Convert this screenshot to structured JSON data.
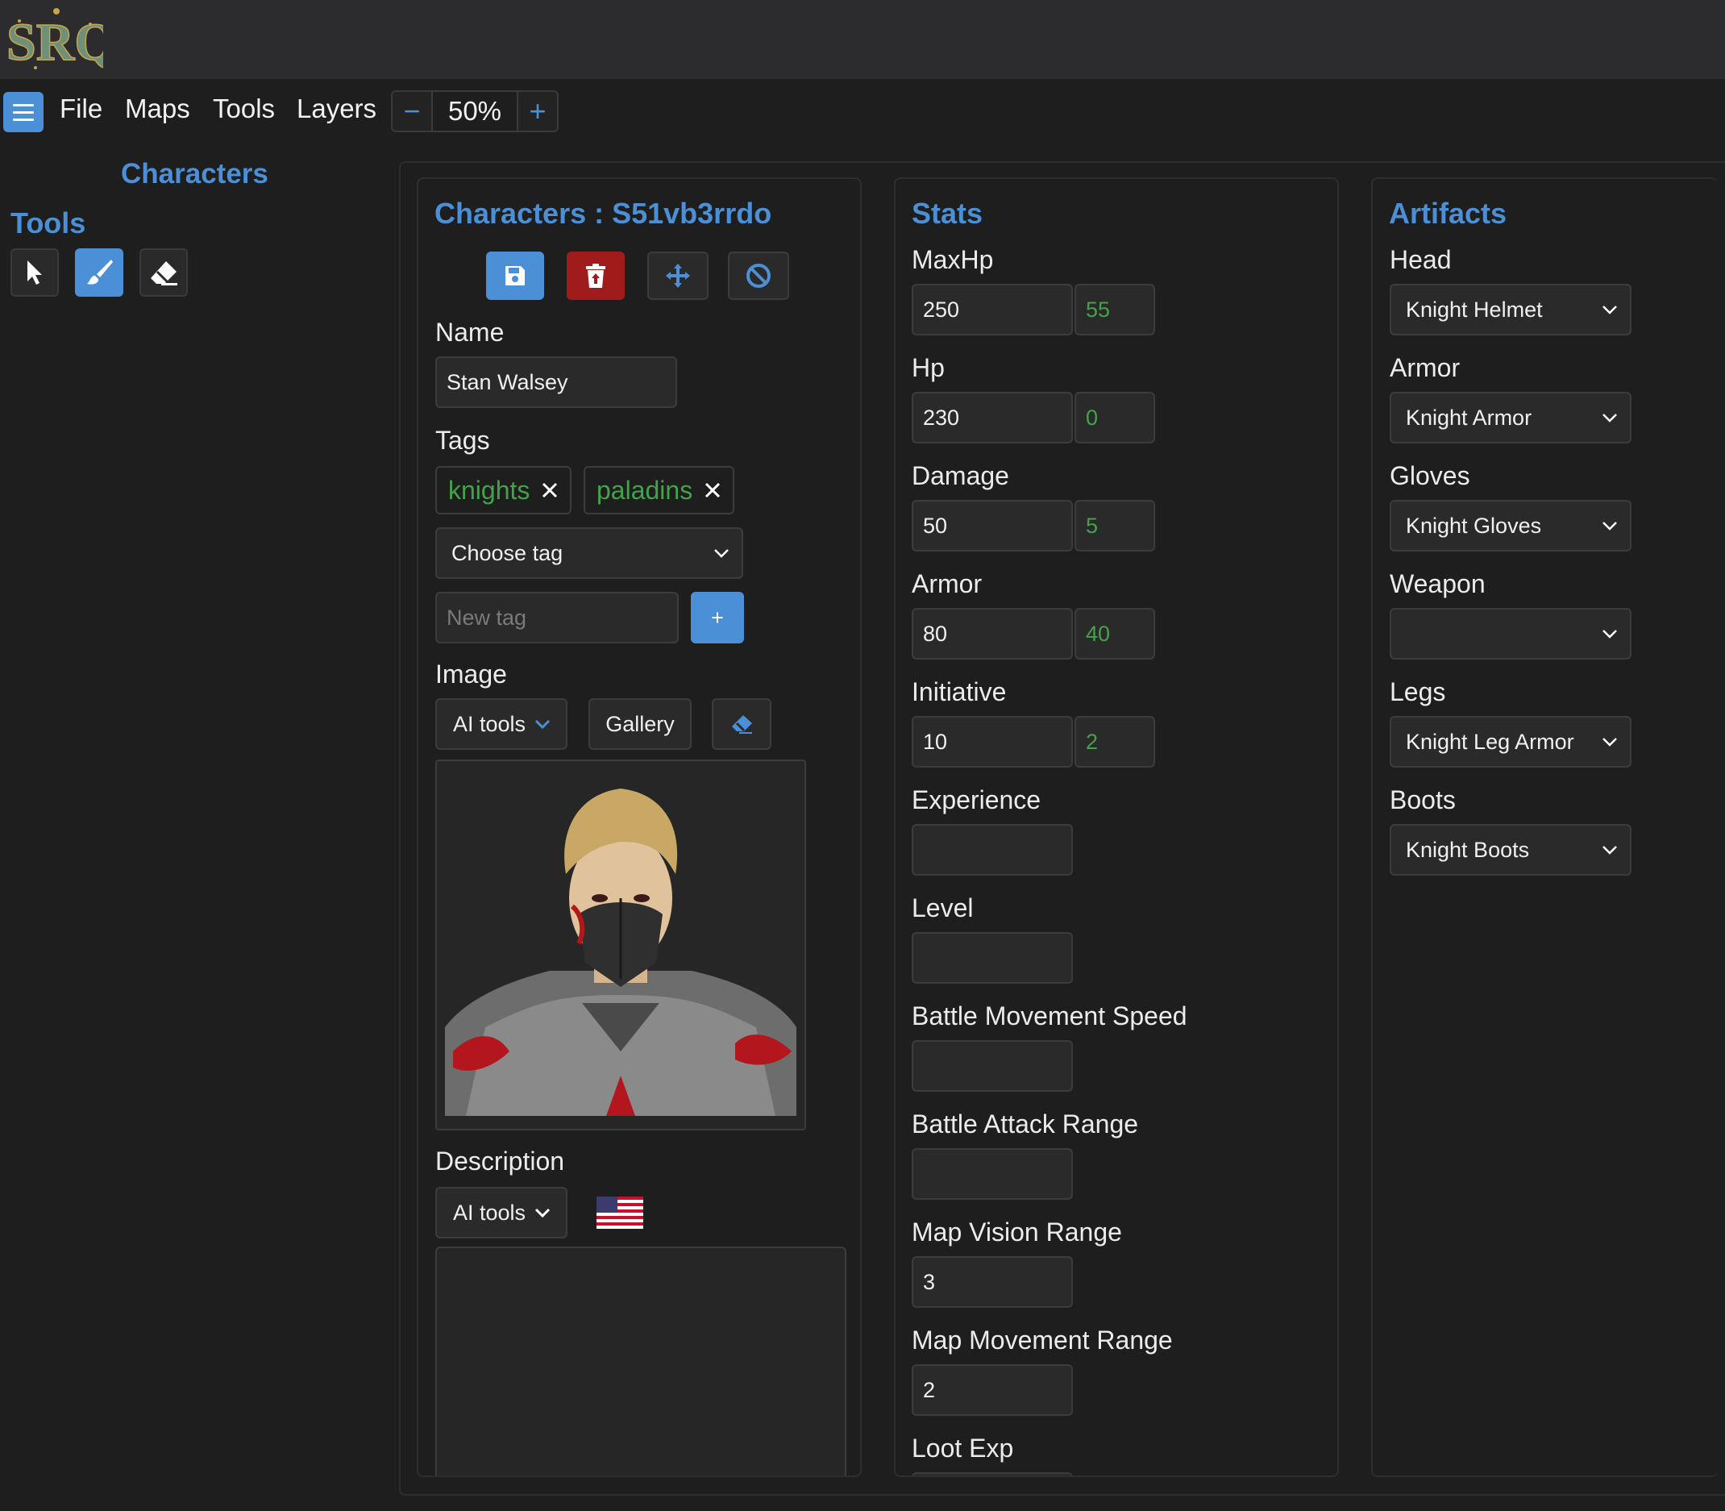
{
  "app": {
    "logo_text": "SRQ"
  },
  "menu": {
    "items": [
      "File",
      "Maps",
      "Tools",
      "Layers"
    ],
    "zoom": "50%"
  },
  "sidebar": {
    "title": "Characters",
    "tools_title": "Tools"
  },
  "character_panel": {
    "title": "Characters : S51vb3rrdo",
    "name_label": "Name",
    "name_value": "Stan Walsey",
    "tags_label": "Tags",
    "tags": [
      "knights",
      "paladins"
    ],
    "choose_tag": "Choose tag",
    "new_tag_placeholder": "New tag",
    "add_tag": "+",
    "image_label": "Image",
    "ai_tools": "AI tools",
    "gallery": "Gallery",
    "description_label": "Description",
    "description_ai_tools": "AI tools"
  },
  "stats": {
    "title": "Stats",
    "fields": [
      {
        "label": "MaxHp",
        "value": "250",
        "bonus": "55"
      },
      {
        "label": "Hp",
        "value": "230",
        "bonus": "0"
      },
      {
        "label": "Damage",
        "value": "50",
        "bonus": "5"
      },
      {
        "label": "Armor",
        "value": "80",
        "bonus": "40"
      },
      {
        "label": "Initiative",
        "value": "10",
        "bonus": "2"
      },
      {
        "label": "Experience",
        "value": ""
      },
      {
        "label": "Level",
        "value": ""
      },
      {
        "label": "Battle Movement Speed",
        "value": ""
      },
      {
        "label": "Battle Attack Range",
        "value": ""
      },
      {
        "label": "Map Vision Range",
        "value": "3"
      },
      {
        "label": "Map Movement Range",
        "value": "2"
      },
      {
        "label": "Loot Exp",
        "value": ""
      }
    ]
  },
  "artifacts": {
    "title": "Artifacts",
    "slots": [
      {
        "label": "Head",
        "value": "Knight Helmet"
      },
      {
        "label": "Armor",
        "value": "Knight Armor"
      },
      {
        "label": "Gloves",
        "value": "Knight Gloves"
      },
      {
        "label": "Weapon",
        "value": ""
      },
      {
        "label": "Legs",
        "value": "Knight Leg Armor"
      },
      {
        "label": "Boots",
        "value": "Knight Boots"
      }
    ]
  },
  "colors": {
    "accent": "#4b8fd6",
    "danger": "#a01c1c",
    "green": "#44a24a",
    "bg": "#1e1e1e"
  }
}
